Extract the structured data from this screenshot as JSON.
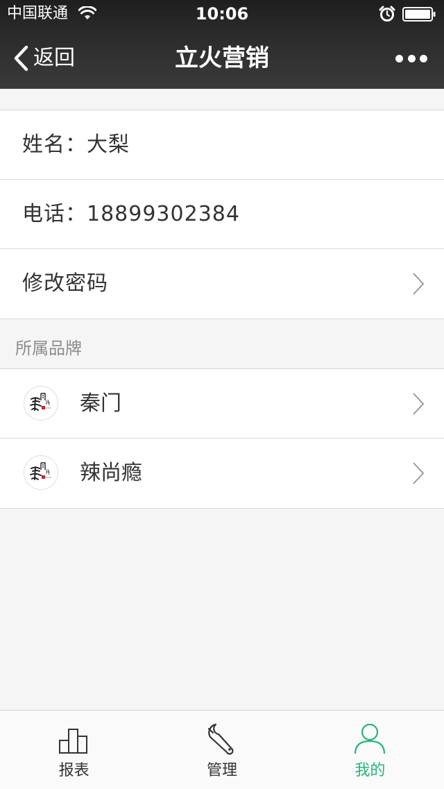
{
  "status_bar": {
    "carrier": "中国联通",
    "time": "10:06"
  },
  "nav": {
    "back_label": "返回",
    "title": "立火营销"
  },
  "profile": {
    "name_label": "姓名：大梨",
    "phone_label": "电话：18899302384",
    "change_password_label": "修改密码"
  },
  "brands": {
    "section_title": "所属品牌",
    "items": [
      {
        "name": "秦门"
      },
      {
        "name": "辣尚瘾"
      }
    ]
  },
  "tabbar": {
    "tabs": [
      {
        "label": "报表",
        "icon": "bar-chart-icon"
      },
      {
        "label": "管理",
        "icon": "wrench-icon"
      },
      {
        "label": "我的",
        "icon": "user-icon"
      }
    ],
    "active_index": 2,
    "active_color": "#26b57d"
  },
  "colors": {
    "nav_background": "#2a2a2a",
    "page_background": "#f5f5f5",
    "accent": "#26b57d"
  }
}
